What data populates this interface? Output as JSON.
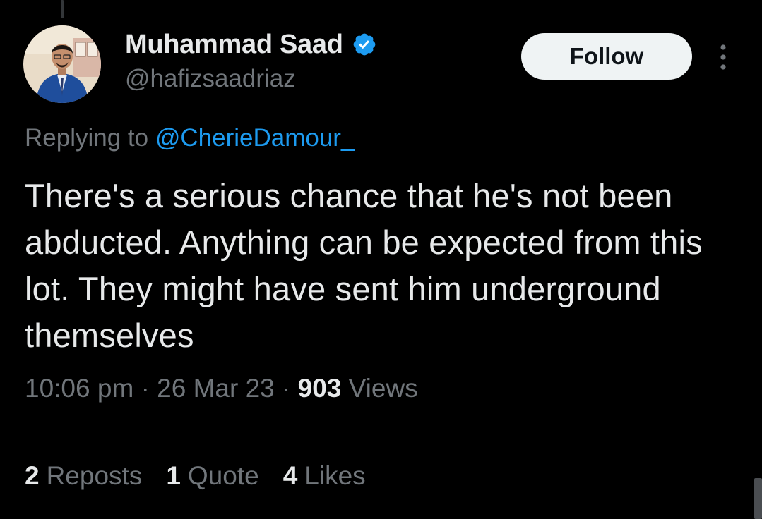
{
  "author": {
    "display_name": "Muhammad Saad",
    "handle": "@hafizsaadriaz",
    "verified": true,
    "avatar_icon": "profile-photo"
  },
  "follow_label": "Follow",
  "more_icon": "more-vertical-icon",
  "reply": {
    "prefix": "Replying to",
    "handle": "@CherieDamour_"
  },
  "tweet": {
    "text": "There's a serious chance that he's not been abducted. Anything can be expected from this lot. They might have sent him underground themselves",
    "time": "10:06 pm",
    "separator": "·",
    "date": "26 Mar 23",
    "views_count": "903",
    "views_label": "Views"
  },
  "stats": {
    "reposts_count": "2",
    "reposts_label": "Reposts",
    "quotes_count": "1",
    "quotes_label": "Quote",
    "likes_count": "4",
    "likes_label": "Likes"
  },
  "colors": {
    "background": "#000000",
    "text_primary": "#e7e9ea",
    "text_secondary": "#71767b",
    "accent": "#1d9bf0",
    "follow_button_bg": "#eff3f4"
  }
}
